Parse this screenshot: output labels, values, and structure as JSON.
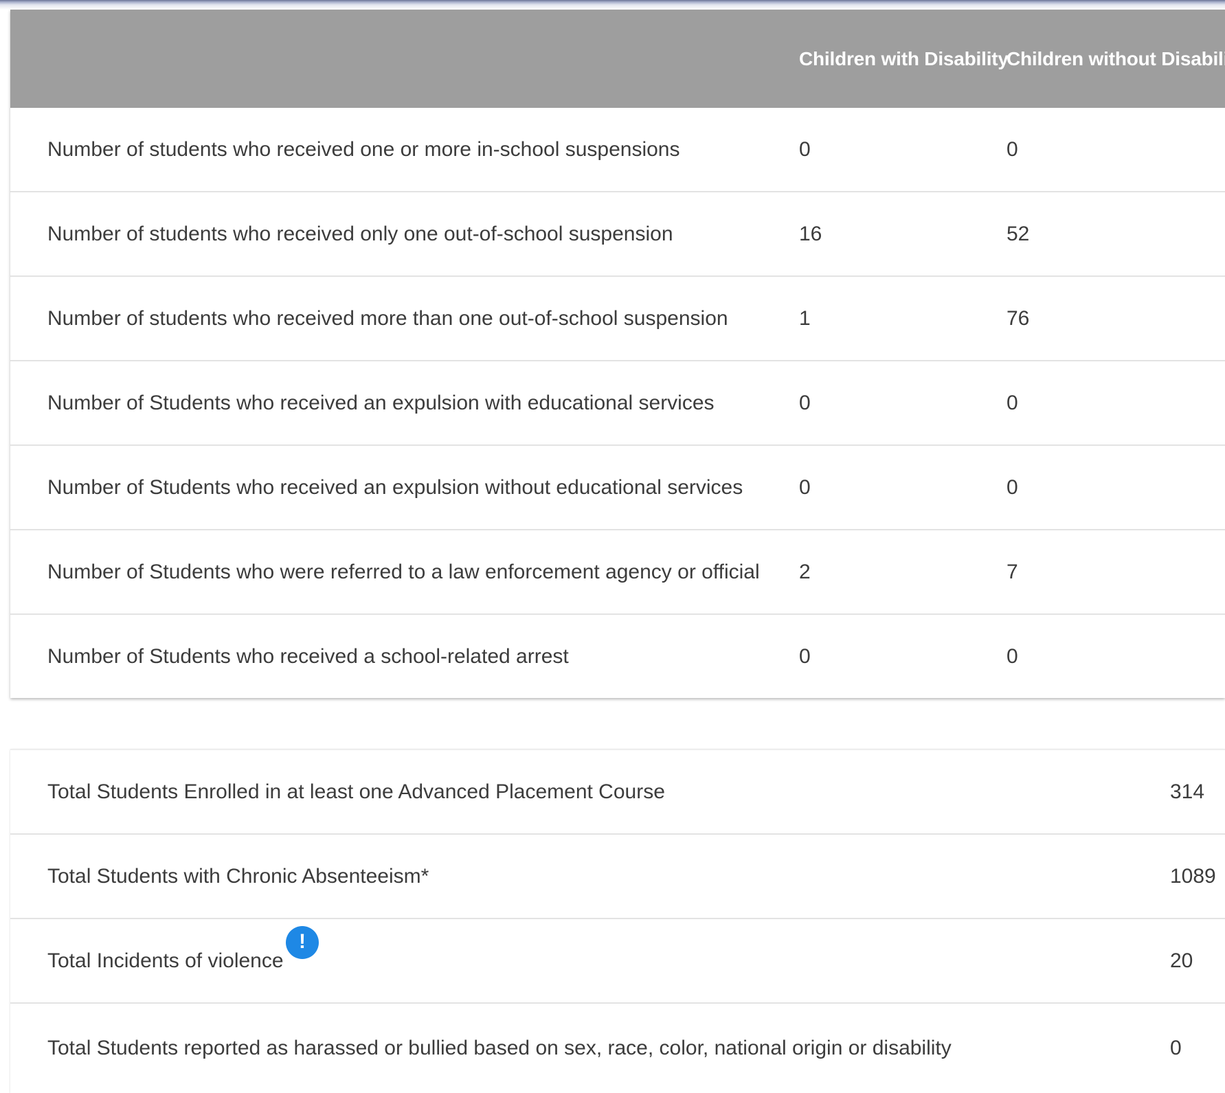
{
  "discipline_table": {
    "columns": {
      "with_disability": "Children with Disability",
      "without_disability": "Children without Disability"
    },
    "rows": [
      {
        "label": "Number of students who received one or more in-school suspensions",
        "with": "0",
        "without": "0"
      },
      {
        "label": "Number of students who received only one out-of-school suspension",
        "with": "16",
        "without": "52"
      },
      {
        "label": "Number of students who received more than one out-of-school suspension",
        "with": "1",
        "without": "76"
      },
      {
        "label": "Number of Students who received an expulsion with educational services",
        "with": "0",
        "without": "0"
      },
      {
        "label": "Number of Students who received an expulsion without educational services",
        "with": "0",
        "without": "0"
      },
      {
        "label": "Number of Students who were referred to a law enforcement agency or official",
        "with": "2",
        "without": "7"
      },
      {
        "label": "Number of Students who received a school-related arrest",
        "with": "0",
        "without": "0"
      }
    ]
  },
  "totals": [
    {
      "label": "Total Students Enrolled in at least one Advanced Placement Course",
      "value": "314"
    },
    {
      "label": "Total Students with Chronic Absenteeism*",
      "value": "1089"
    },
    {
      "label": "Total Incidents of violence",
      "value": "20",
      "info_icon": "!"
    },
    {
      "label": "Total Students reported as harassed or bullied based on sex, race, color, national origin or disability",
      "value": "0"
    }
  ],
  "icons": {
    "info": "info-icon"
  },
  "colors": {
    "header_bg": "#9e9e9e",
    "info_icon": "#1e88e5"
  }
}
